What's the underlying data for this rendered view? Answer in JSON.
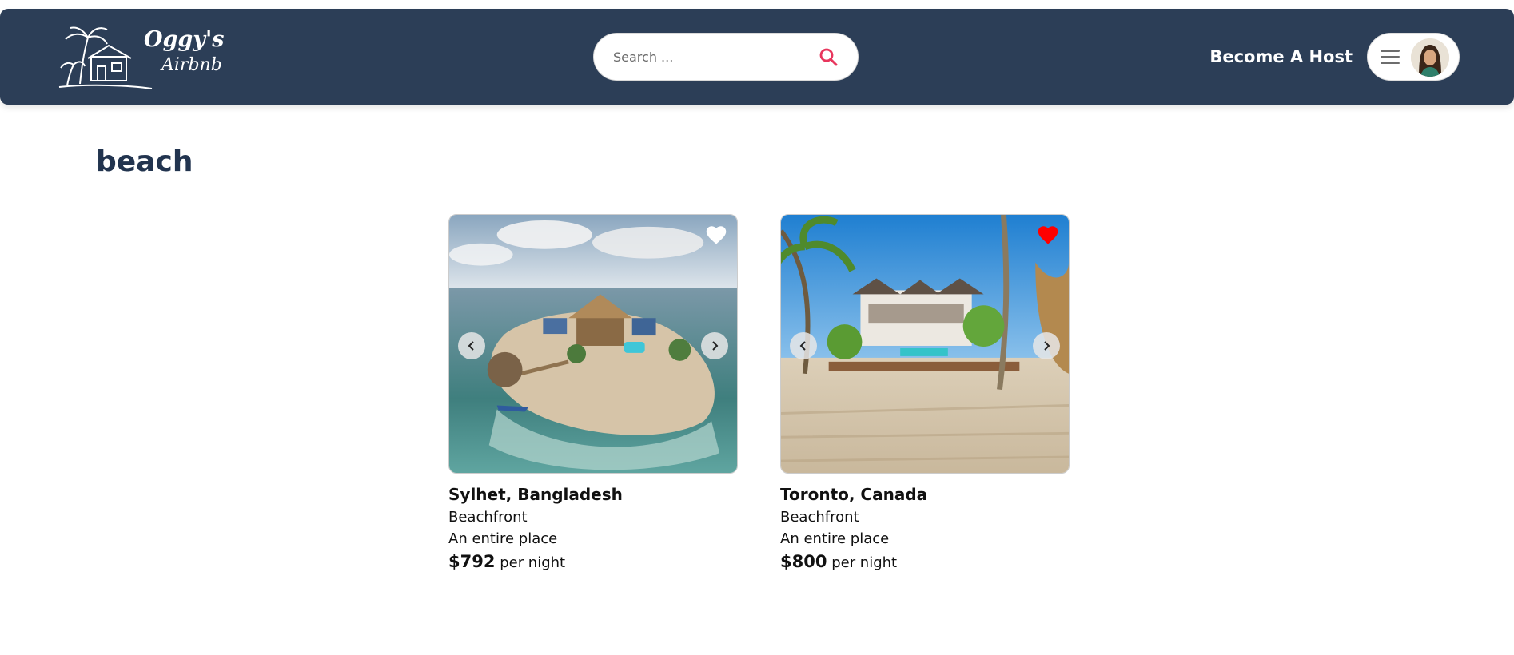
{
  "header": {
    "logo_text_line1": "Oggy's",
    "logo_text_line2": "Airbnb",
    "search_placeholder": "Search ...",
    "host_label": "Become A Host",
    "colors": {
      "nav_bg": "#2c3e57",
      "search_accent": "#e8365d"
    }
  },
  "page": {
    "title": "beach"
  },
  "listings": [
    {
      "location": "Sylhet, Bangladesh",
      "category": "Beachfront",
      "type": "An entire place",
      "price": "$792",
      "price_suffix": "per night",
      "favorited": false
    },
    {
      "location": "Toronto, Canada",
      "category": "Beachfront",
      "type": "An entire place",
      "price": "$800",
      "price_suffix": "per night",
      "favorited": true
    }
  ],
  "icons": {
    "search": "search-icon",
    "menu": "hamburger-menu-icon",
    "favorite": "heart-icon",
    "prev": "chevron-left-icon",
    "next": "chevron-right-icon"
  }
}
